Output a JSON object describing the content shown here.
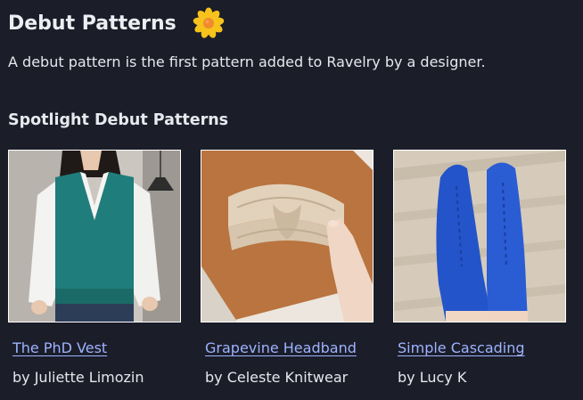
{
  "page": {
    "title": "Debut Patterns",
    "title_icon": "flower-icon",
    "intro": "A debut pattern is the first pattern added to Ravelry by a designer.",
    "section_heading": "Spotlight Debut Patterns"
  },
  "colors": {
    "background": "#1b1d29",
    "link": "#9db3ff",
    "text": "#e6e7ec"
  },
  "patterns": [
    {
      "name": "The PhD Vest",
      "designer": "by Juliette Limozin",
      "image_icon": "vest-photo"
    },
    {
      "name": "Grapevine Headband",
      "designer": "by Celeste Knitwear",
      "image_icon": "headband-photo"
    },
    {
      "name": "Simple Cascading",
      "designer": "by Lucy K",
      "image_icon": "socks-photo"
    }
  ]
}
